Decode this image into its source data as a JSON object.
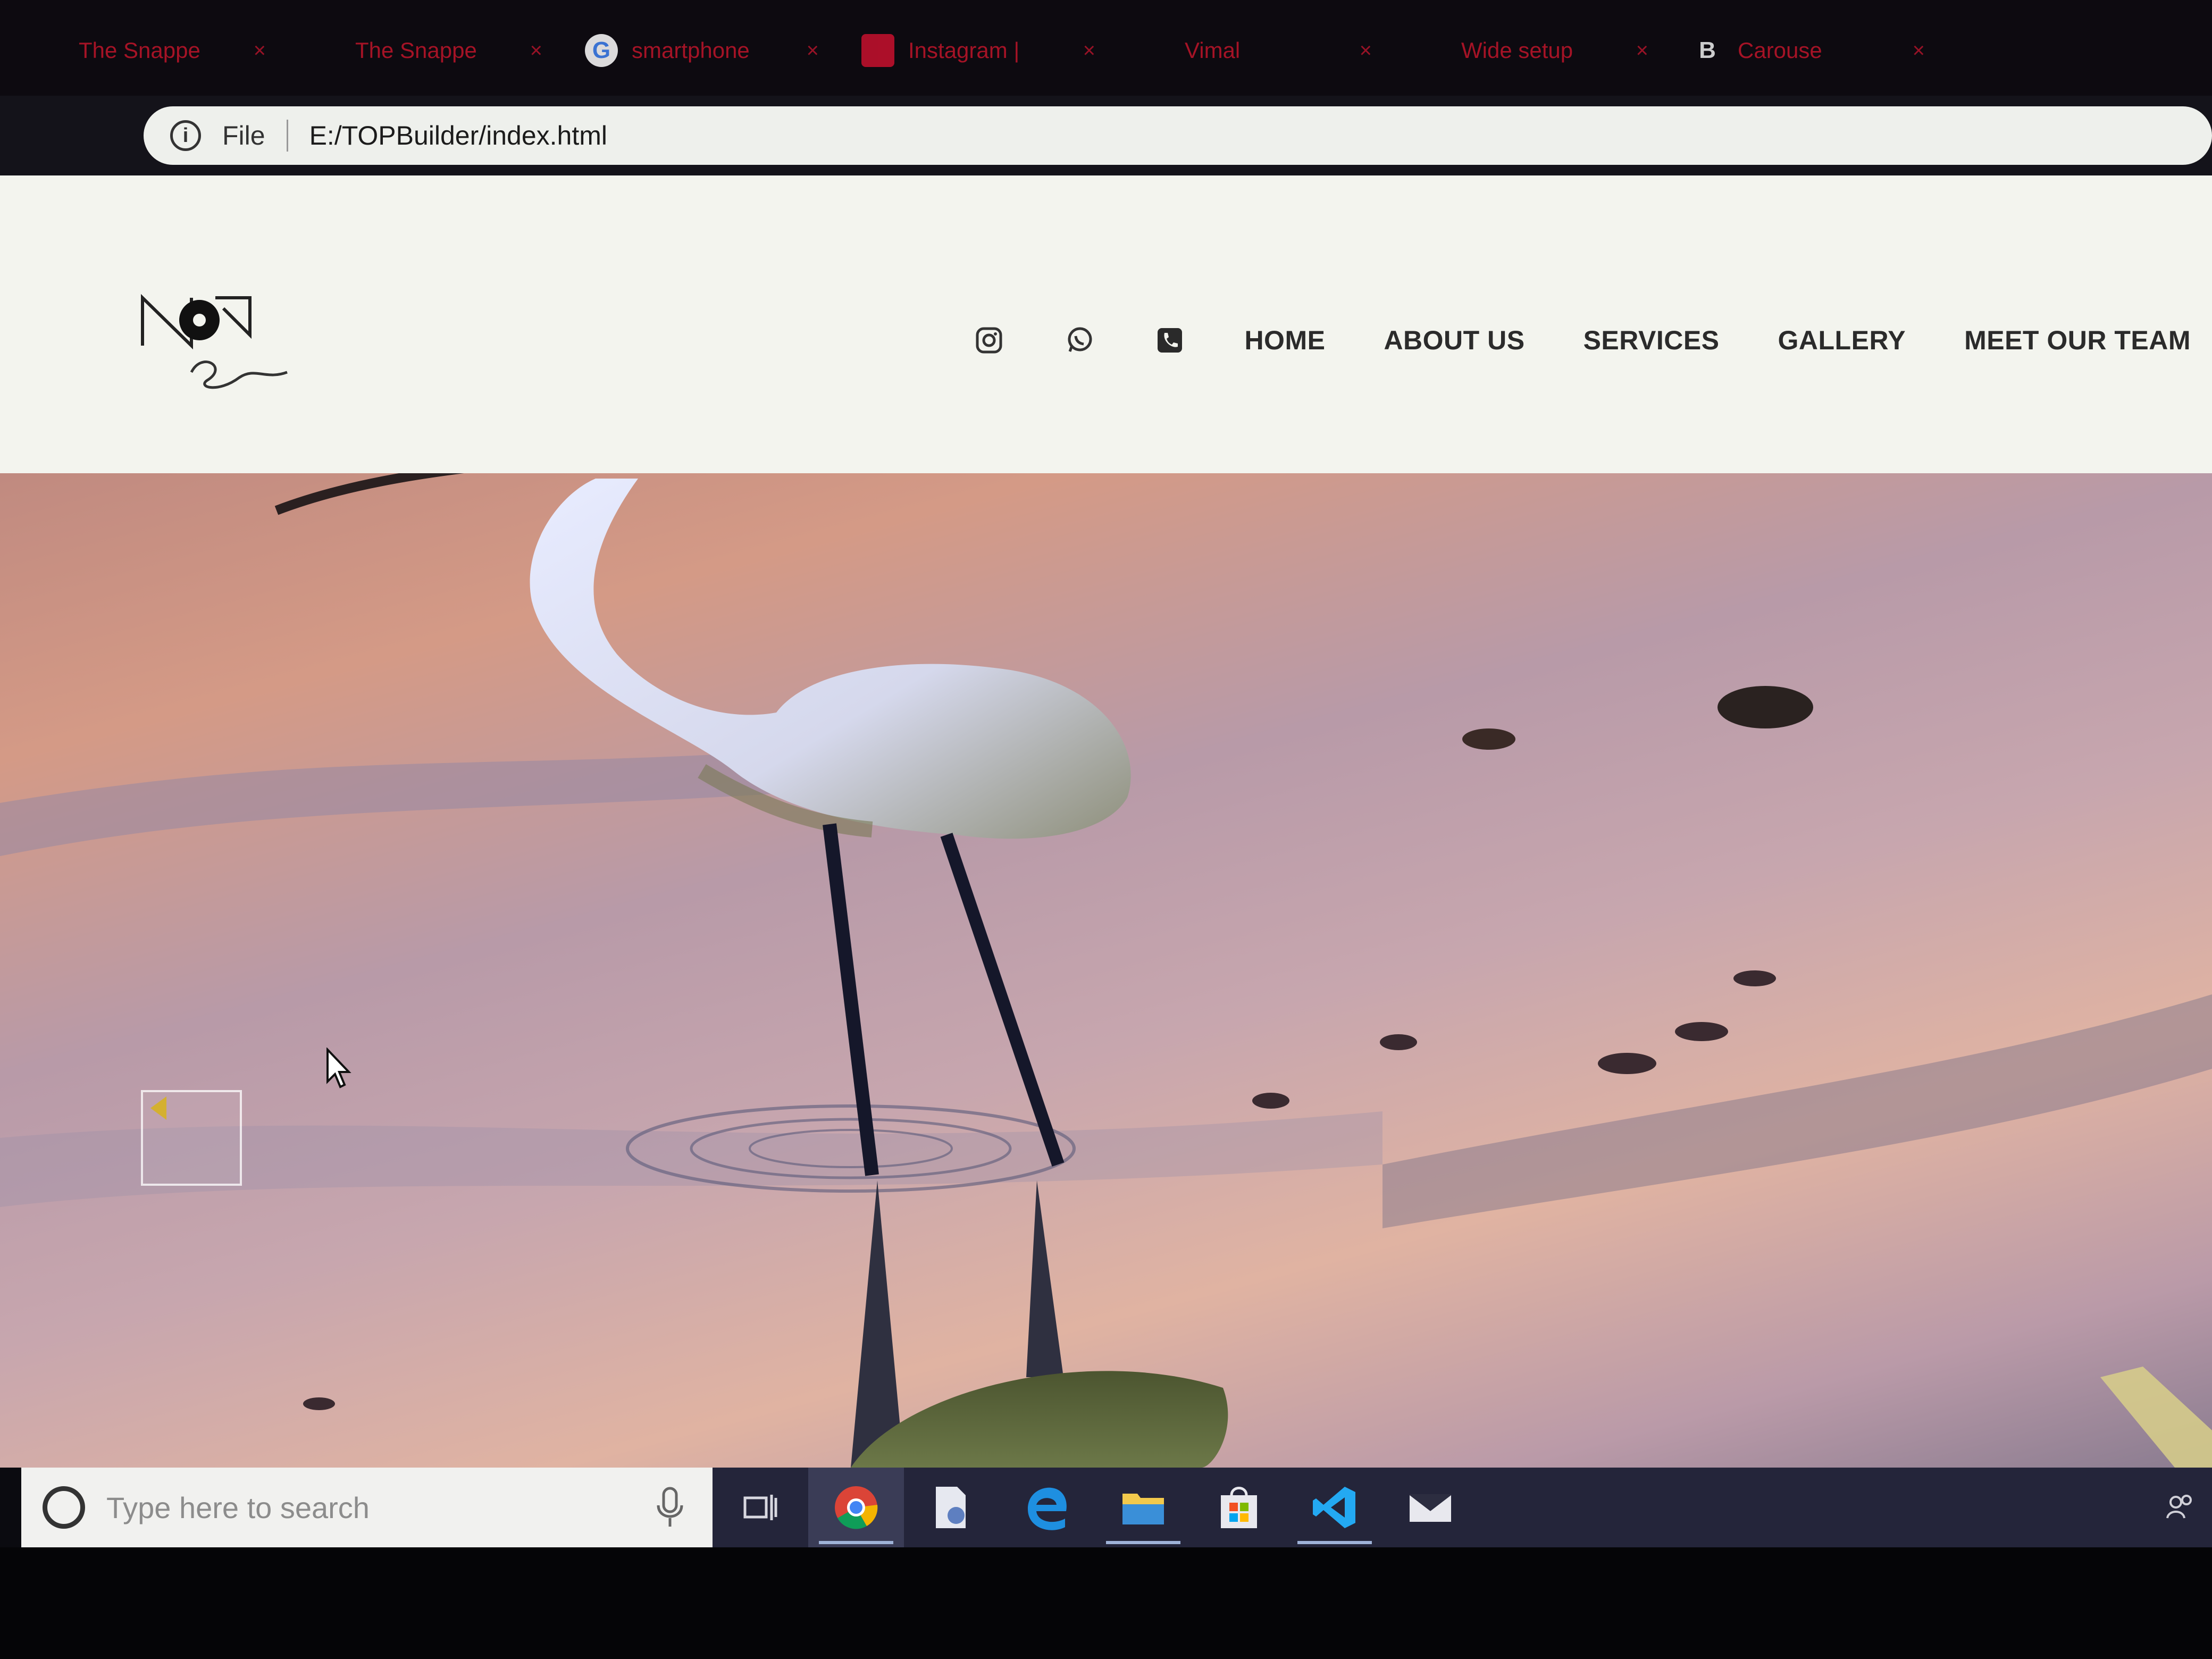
{
  "browser": {
    "tabs": [
      {
        "title": "The Snappe",
        "favicon": "dot-icon"
      },
      {
        "title": "The Snappe",
        "favicon": "dot-icon"
      },
      {
        "title": "smartphone",
        "favicon": "google-icon"
      },
      {
        "title": "Instagram |",
        "favicon": "instagram-icon"
      },
      {
        "title": "Vimal",
        "favicon": "dot-icon"
      },
      {
        "title": "Wide setup",
        "favicon": "dot-icon"
      },
      {
        "title": "Carouse",
        "favicon": "bootstrap-icon"
      }
    ],
    "close_glyph": "×",
    "address": {
      "info_glyph": "i",
      "scheme_label": "File",
      "url": "E:/TOPBuilder/index.html"
    }
  },
  "site": {
    "nav": {
      "home": "HOME",
      "about": "ABOUT US",
      "services": "SERVICES",
      "gallery": "GALLERY",
      "team": "MEET OUR TEAM"
    }
  },
  "taskbar": {
    "search_placeholder": "Type here to search",
    "pinned": [
      "task-view-icon",
      "chrome-icon",
      "file-share-icon",
      "edge-icon",
      "file-explorer-icon",
      "store-icon",
      "vscode-icon",
      "mail-icon"
    ]
  },
  "colors": {
    "nav_text": "#2b2b2b",
    "tab_text": "#c0152a",
    "taskbar": "#24253a",
    "prev_arrow": "#d4b030"
  }
}
